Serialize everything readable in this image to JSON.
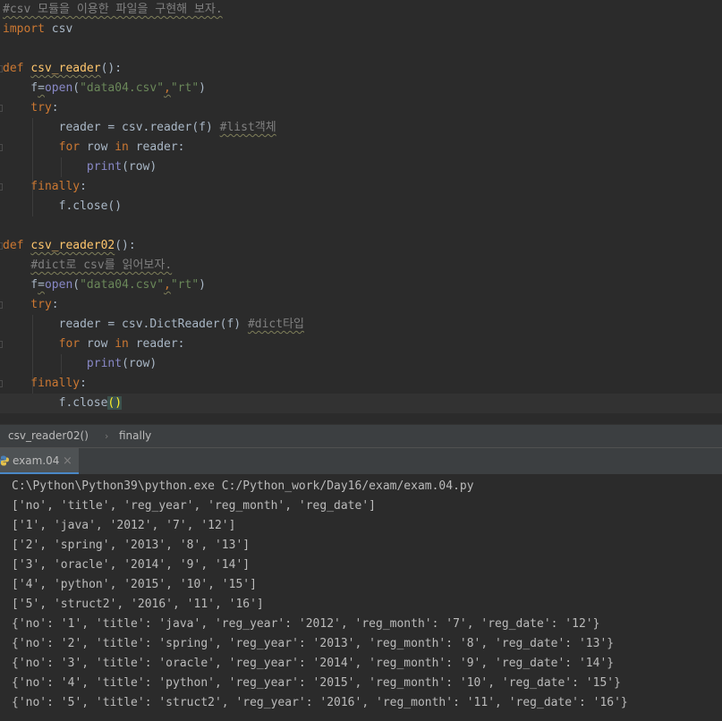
{
  "editor": {
    "lines": [
      [
        {
          "t": "#csv 모듈을 이용한 파일을 구현해 보자.",
          "c": "cm sq"
        }
      ],
      [
        {
          "t": "import",
          "c": "kw"
        },
        {
          "t": " csv",
          "c": ""
        }
      ],
      [],
      [
        {
          "t": "def",
          "c": "kw"
        },
        {
          "t": " ",
          "c": ""
        },
        {
          "t": "csv_reader",
          "c": "fn sq"
        },
        {
          "t": "():",
          "c": ""
        }
      ],
      [
        {
          "t": "    f",
          "c": ""
        },
        {
          "t": "=",
          "c": "sq"
        },
        {
          "t": "open",
          "c": "bi"
        },
        {
          "t": "(",
          "c": ""
        },
        {
          "t": "\"data04.csv\"",
          "c": "str"
        },
        {
          "t": ",",
          "c": "kw sq"
        },
        {
          "t": "\"rt\"",
          "c": "str"
        },
        {
          "t": ")",
          "c": ""
        }
      ],
      [
        {
          "t": "    try",
          "c": "kw"
        },
        {
          "t": ":",
          "c": ""
        }
      ],
      [
        {
          "t": "        reader = csv.reader(f) ",
          "c": ""
        },
        {
          "t": "#list객체",
          "c": "cm sq"
        }
      ],
      [
        {
          "t": "        for",
          "c": "kw"
        },
        {
          "t": " row ",
          "c": ""
        },
        {
          "t": "in",
          "c": "kw"
        },
        {
          "t": " reader:",
          "c": ""
        }
      ],
      [
        {
          "t": "            ",
          "c": ""
        },
        {
          "t": "print",
          "c": "bi"
        },
        {
          "t": "(row)",
          "c": ""
        }
      ],
      [
        {
          "t": "    finally",
          "c": "kw"
        },
        {
          "t": ":",
          "c": ""
        }
      ],
      [
        {
          "t": "        f.close()",
          "c": ""
        }
      ],
      [],
      [
        {
          "t": "def",
          "c": "kw"
        },
        {
          "t": " ",
          "c": ""
        },
        {
          "t": "csv_reader02",
          "c": "fn sq"
        },
        {
          "t": "():",
          "c": ""
        }
      ],
      [
        {
          "t": "    ",
          "c": ""
        },
        {
          "t": "#dict로 csv를 읽어보자.",
          "c": "cm sq"
        }
      ],
      [
        {
          "t": "    f",
          "c": ""
        },
        {
          "t": "=",
          "c": "sq"
        },
        {
          "t": "open",
          "c": "bi"
        },
        {
          "t": "(",
          "c": ""
        },
        {
          "t": "\"data04.csv\"",
          "c": "str"
        },
        {
          "t": ",",
          "c": "kw sq"
        },
        {
          "t": "\"rt\"",
          "c": "str"
        },
        {
          "t": ")",
          "c": ""
        }
      ],
      [
        {
          "t": "    try",
          "c": "kw"
        },
        {
          "t": ":",
          "c": ""
        }
      ],
      [
        {
          "t": "        reader = csv.DictReader(f) ",
          "c": ""
        },
        {
          "t": "#dict타입",
          "c": "cm sq"
        }
      ],
      [
        {
          "t": "        for",
          "c": "kw"
        },
        {
          "t": " row ",
          "c": ""
        },
        {
          "t": "in",
          "c": "kw"
        },
        {
          "t": " reader:",
          "c": ""
        }
      ],
      [
        {
          "t": "            ",
          "c": ""
        },
        {
          "t": "print",
          "c": "bi"
        },
        {
          "t": "(row)",
          "c": ""
        }
      ],
      [
        {
          "t": "    finally",
          "c": "kw"
        },
        {
          "t": ":",
          "c": ""
        }
      ],
      [
        {
          "t": "        f.close",
          "c": ""
        },
        {
          "t": "()",
          "c": "caret-brace"
        }
      ]
    ]
  },
  "breadcrumb": {
    "item1": "csv_reader02()",
    "sep": "›",
    "item2": "finally"
  },
  "run": {
    "tab_label": "exam.04",
    "close": "×"
  },
  "console": {
    "lines": [
      "C:\\Python\\Python39\\python.exe C:/Python_work/Day16/exam/exam.04.py",
      "['no', 'title', 'reg_year', 'reg_month', 'reg_date']",
      "['1', 'java', '2012', '7', '12']",
      "['2', 'spring', '2013', '8', '13']",
      "['3', 'oracle', '2014', '9', '14']",
      "['4', 'python', '2015', '10', '15']",
      "['5', 'struct2', '2016', '11', '16']",
      "{'no': '1', 'title': 'java', 'reg_year': '2012', 'reg_month': '7', 'reg_date': '12'}",
      "{'no': '2', 'title': 'spring', 'reg_year': '2013', 'reg_month': '8', 'reg_date': '13'}",
      "{'no': '3', 'title': 'oracle', 'reg_year': '2014', 'reg_month': '9', 'reg_date': '14'}",
      "{'no': '4', 'title': 'python', 'reg_year': '2015', 'reg_month': '10', 'reg_date': '15'}",
      "{'no': '5', 'title': 'struct2', 'reg_year': '2016', 'reg_month': '11', 'reg_date': '16'}"
    ]
  },
  "colors": {
    "keyword": "#cc7832",
    "function": "#ffc66d",
    "string": "#6a8759",
    "comment": "#808080",
    "builtin": "#8888c6",
    "background": "#2b2b2b"
  }
}
